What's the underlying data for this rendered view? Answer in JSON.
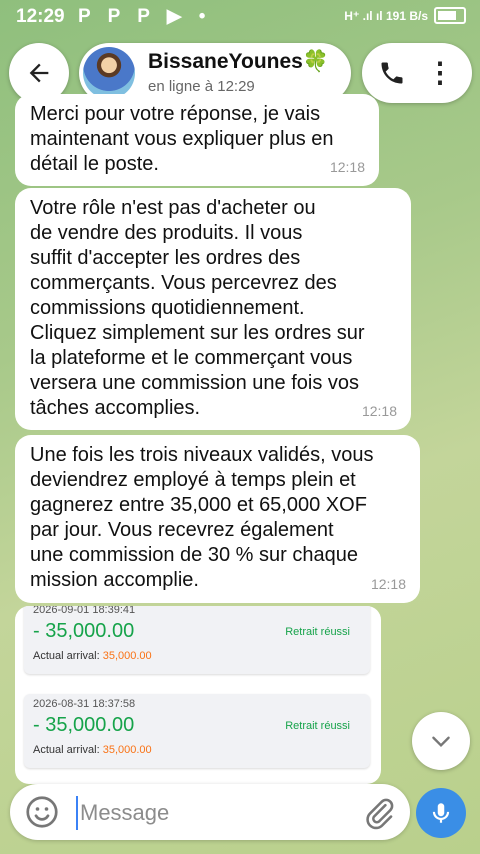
{
  "statusbar": {
    "time": "12:29",
    "apps": "P P P ▶ •",
    "signal": "H⁺ .ıl ıl 191 B/s"
  },
  "header": {
    "contact_name": "BissaneYounes",
    "clover": "🍀",
    "status": "en ligne à 12:29"
  },
  "messages": [
    {
      "text": "Merci pour votre réponse, je vais\nmaintenant vous expliquer plus en\ndétail le poste.",
      "time": "12:18"
    },
    {
      "text": "Votre rôle n'est pas d'acheter ou\nde vendre des produits. Il vous\nsuffit d'accepter les ordres des\ncommerçants. Vous percevrez des\ncommissions quotidiennement.\nCliquez simplement sur les ordres sur\nla plateforme et le commerçant vous\nversera une commission une fois vos\ntâches accomplies.",
      "time": "12:18"
    },
    {
      "text": "Une fois les trois niveaux validés, vous\ndeviendrez employé à temps plein et\ngagnerez entre 35,000 et 65,000 XOF\npar jour. Vous recevrez également\nune commission de 30 % sur chaque\nmission accomplie.",
      "time": "12:18"
    }
  ],
  "records": [
    {
      "date": "2026-09-01 18:39:41",
      "amount": "- 35,000.00",
      "status": "Retrait réussi",
      "arrival_label": "Actual arrival:",
      "arrival_value": "35,000.00"
    },
    {
      "date": "2026-08-31 18:37:58",
      "amount": "- 35,000.00",
      "status": "Retrait réussi",
      "arrival_label": "Actual arrival:",
      "arrival_value": "35,000.00"
    }
  ],
  "composer": {
    "placeholder": "Message"
  },
  "colors": {
    "accent": "#3a8ee6",
    "success": "#16a34a",
    "arrival": "#f97316"
  }
}
